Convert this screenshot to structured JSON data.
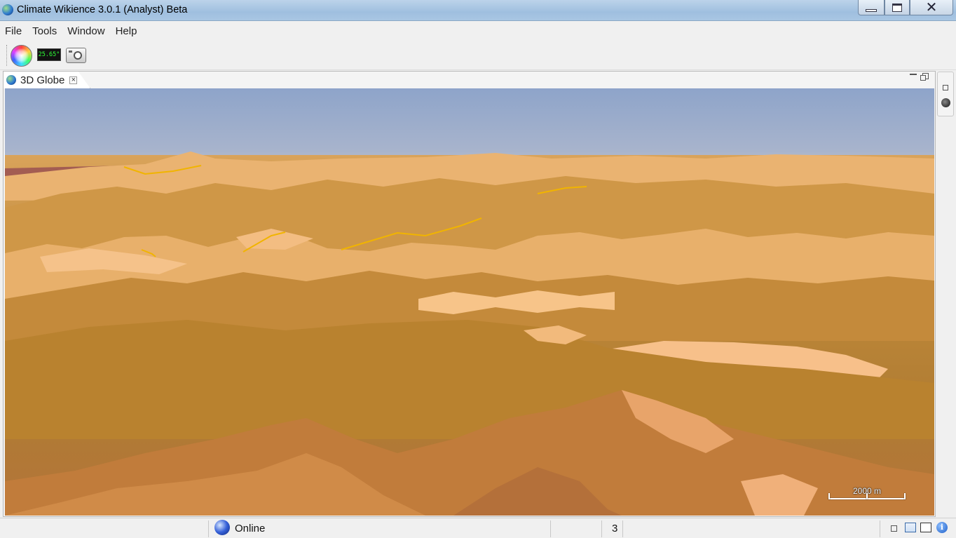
{
  "window": {
    "title": "Climate Wikience 3.0.1 (Analyst) Beta"
  },
  "menu": {
    "items": [
      "File",
      "Tools",
      "Window",
      "Help"
    ]
  },
  "toolbar": {
    "temperature_readout": "25.65°",
    "icons": [
      "color-wheel-icon",
      "temperature-display-icon",
      "camera-icon"
    ]
  },
  "view": {
    "tab_label": "3D Globe",
    "scale_label": "2000 m"
  },
  "status": {
    "connection": "Online",
    "count": "3"
  },
  "colors": {
    "sky_top": "#8da3c9",
    "sky_horizon": "#c8c4c6",
    "terrain_light": "#f5b36f",
    "terrain_mid": "#c78a3a",
    "terrain_dark": "#8a6320",
    "trail": "#f1b400",
    "pink_region": "#e89aa0"
  }
}
